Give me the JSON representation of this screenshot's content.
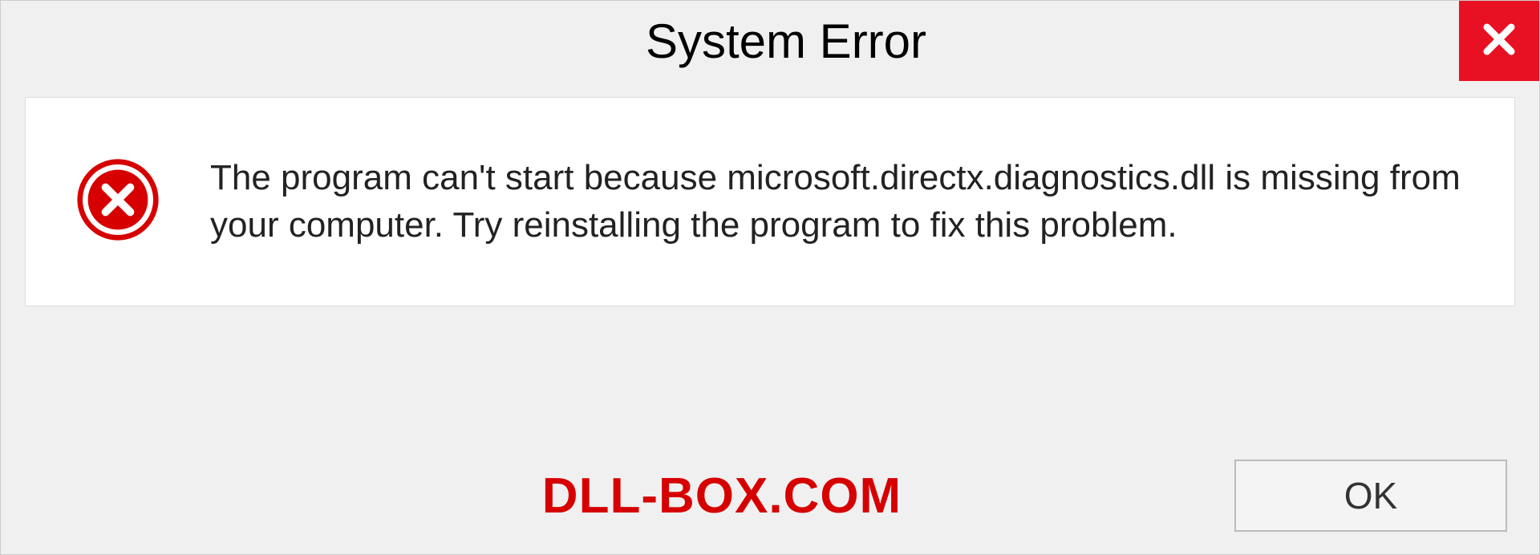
{
  "dialog": {
    "title": "System Error",
    "message": "The program can't start because microsoft.directx.diagnostics.dll is missing from your computer. Try reinstalling the program to fix this problem.",
    "ok_label": "OK"
  },
  "watermark": "DLL-BOX.COM",
  "colors": {
    "close_red": "#e81123",
    "error_red": "#d60000",
    "watermark_red": "#d60000"
  }
}
